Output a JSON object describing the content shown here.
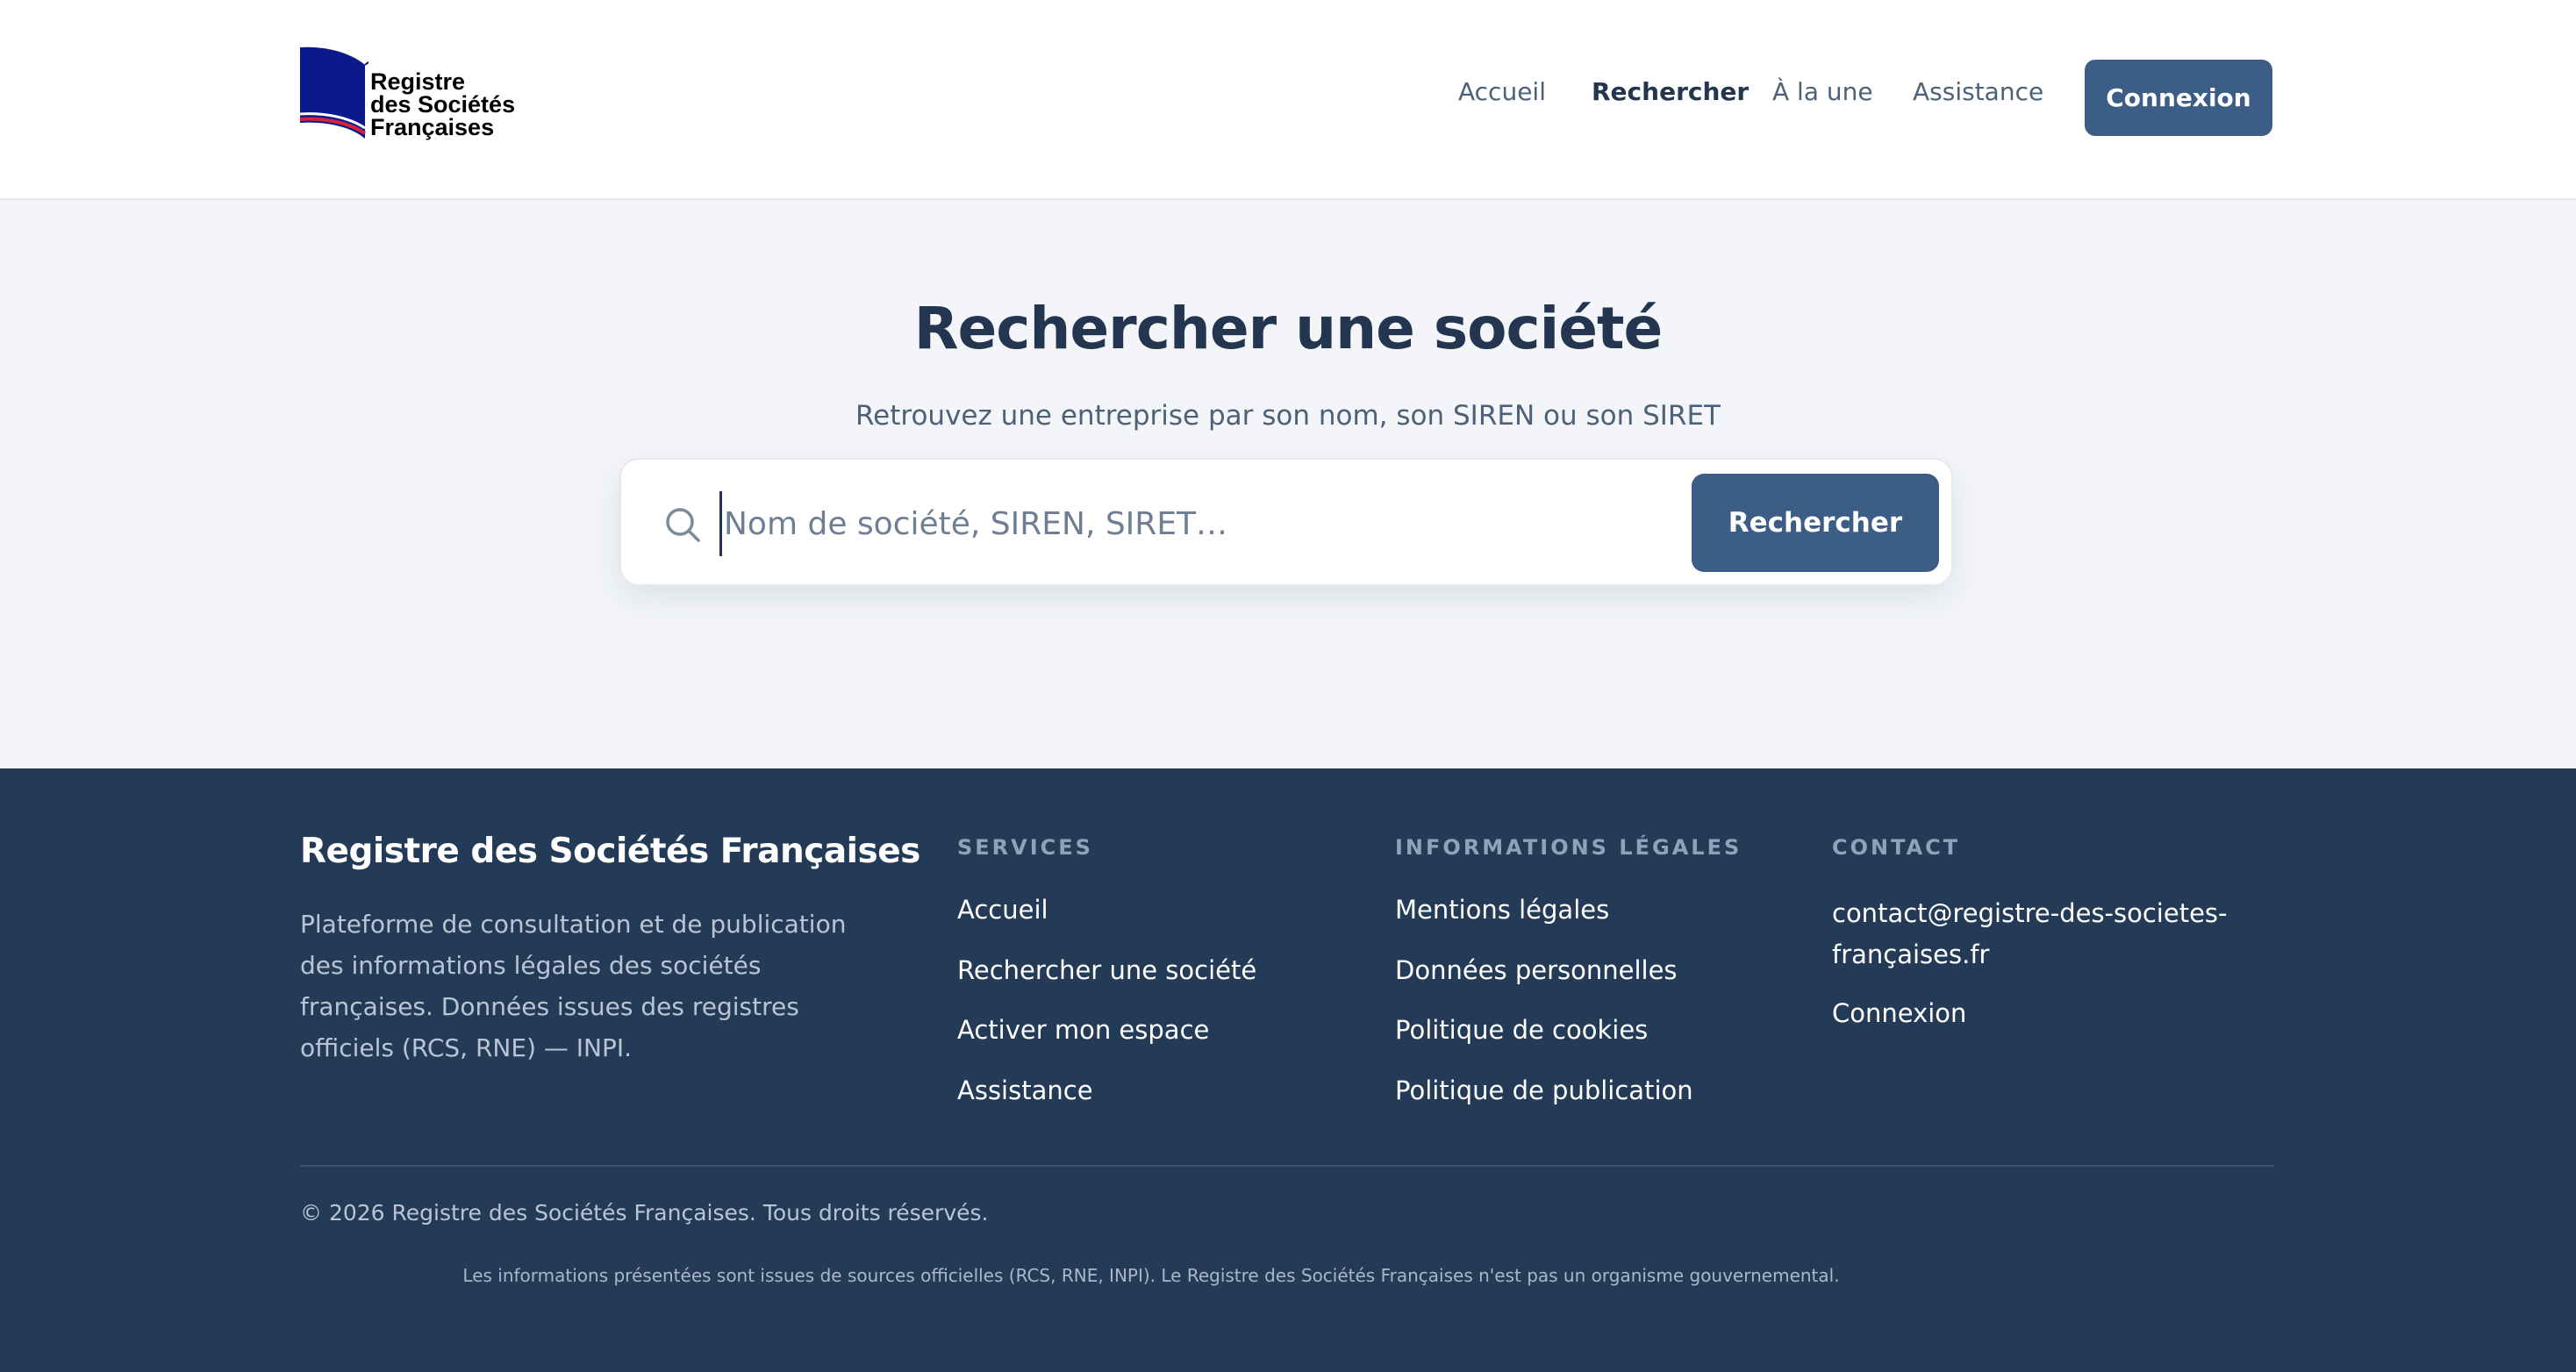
{
  "header": {
    "logo": {
      "line1": "Registre",
      "line2": "des Sociétés",
      "line3": "Françaises"
    },
    "nav": [
      {
        "label": "Accueil",
        "active": false
      },
      {
        "label": "Rechercher",
        "active": true
      },
      {
        "label": "À la une",
        "active": false
      },
      {
        "label": "Assistance",
        "active": false
      }
    ],
    "login_label": "Connexion"
  },
  "hero": {
    "title": "Rechercher une société",
    "subtitle": "Retrouvez une entreprise par son nom, son SIREN ou son SIRET",
    "search": {
      "placeholder": "Nom de société, SIREN, SIRET…",
      "value": "",
      "button_label": "Rechercher",
      "icon": "search-icon"
    }
  },
  "footer": {
    "brand": "Registre des Sociétés Françaises",
    "description": "Plateforme de consultation et de publication des informations légales des sociétés françaises. Données issues des registres officiels (RCS, RNE) — INPI.",
    "columns": [
      {
        "title": "SERVICES",
        "links": [
          "Accueil",
          "Rechercher une société",
          "Activer mon espace",
          "Assistance"
        ]
      },
      {
        "title": "INFORMATIONS LÉGALES",
        "links": [
          "Mentions légales",
          "Données personnelles",
          "Politique de cookies",
          "Politique de publication"
        ]
      },
      {
        "title": "CONTACT",
        "email": "contact@registre-des-societes-françaises.fr",
        "links": [
          "Connexion"
        ]
      }
    ],
    "copyright": "© 2026 Registre des Sociétés Françaises. Tous droits réservés.",
    "disclaimer": "Les informations présentées sont issues de sources officielles (RCS, RNE, INPI). Le Registre des Sociétés Françaises n'est pas un organisme gouvernemental."
  },
  "colors": {
    "primary": "#3c5d85",
    "dark": "#243b57",
    "heading": "#24364f",
    "background": "#f3f5f8",
    "logo_blue": "#0a1a8c",
    "logo_red": "#d8203c"
  }
}
